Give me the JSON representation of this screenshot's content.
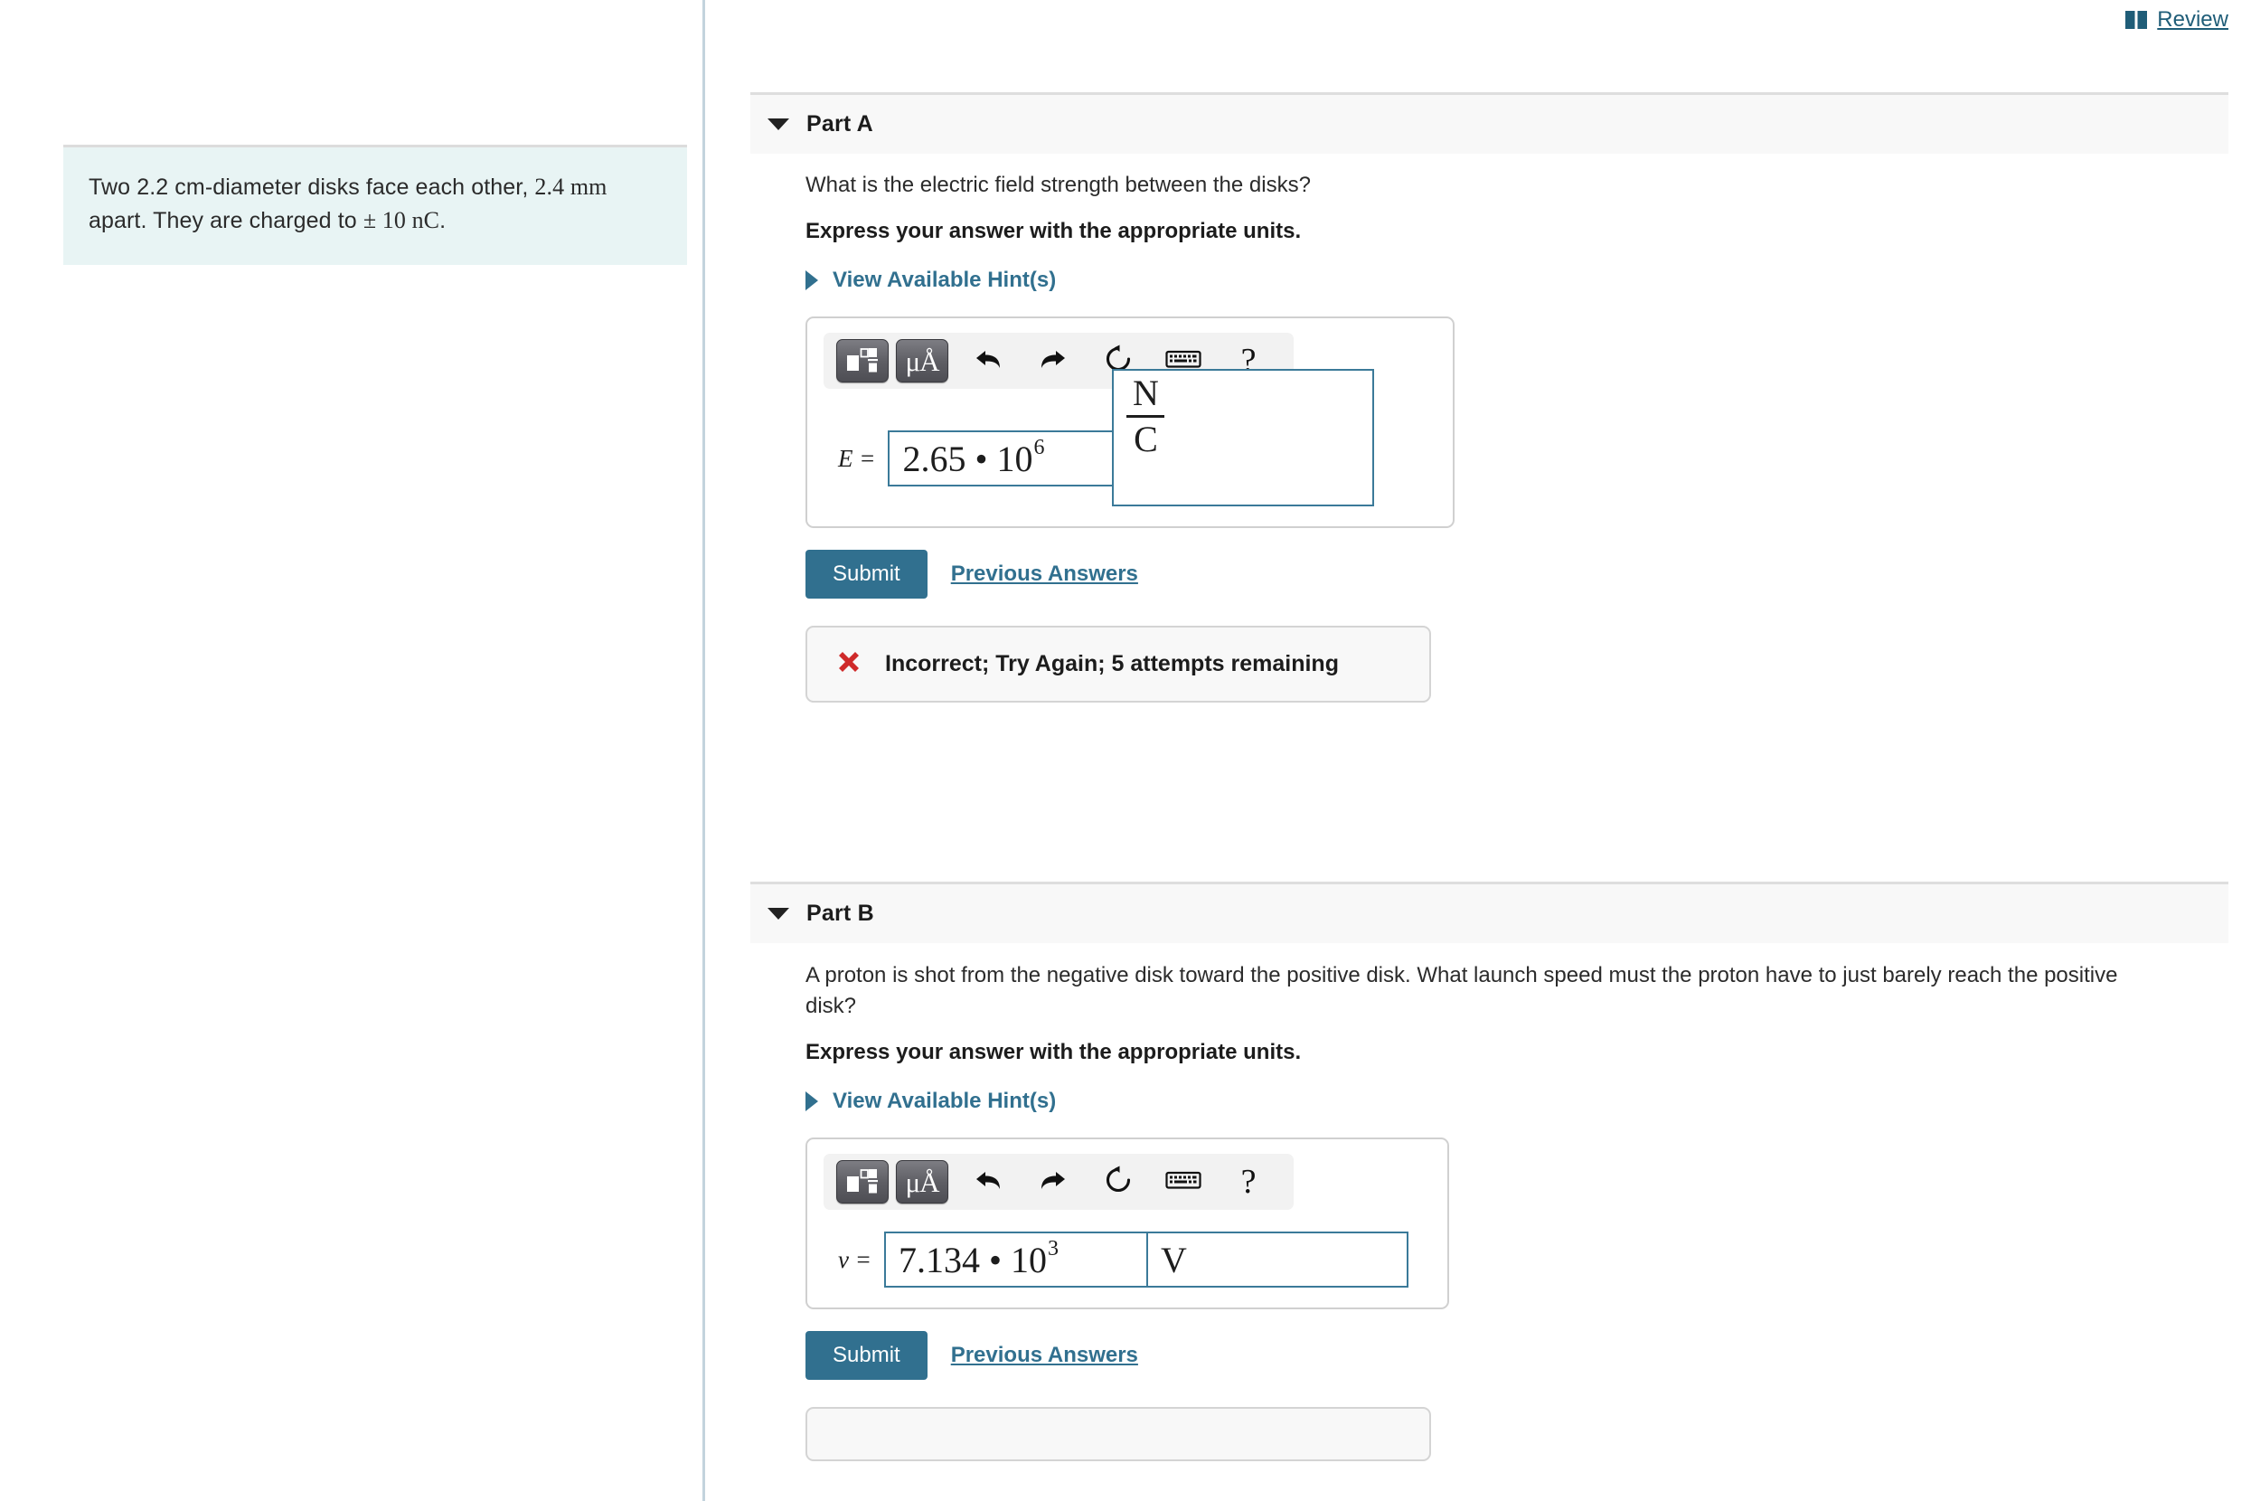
{
  "header": {
    "review_label": "Review",
    "book_icon": "book-icon"
  },
  "problem": {
    "text_part1": "Two 2.2 cm-diameter disks face each other, ",
    "text_math1": "2.4 mm",
    "text_part2": " apart. They are charged to  ",
    "text_math2": "± 10 nC",
    "text_part3": "."
  },
  "colors": {
    "accent": "#31708f",
    "link": "#1f5d78",
    "input_border": "#3b7a99",
    "problem_bg": "#e8f4f4",
    "panel_bg": "#f8f8f8",
    "error": "#cf2a2a"
  },
  "toolbar": {
    "template_button": "math-template-button",
    "units_button_label": "μÅ",
    "undo_label": "undo-icon",
    "redo_label": "redo-icon",
    "reset_label": "reset-icon",
    "keyboard_label": "keyboard-icon",
    "help_label": "?"
  },
  "parts": [
    {
      "title": "Part A",
      "question": "What is the electric field strength between the disks?",
      "express": "Express your answer with the appropriate units.",
      "hint_label": "View Available Hint(s)",
      "answer": {
        "variable": "E =",
        "value_mantissa": "2.65 • 10",
        "value_exponent": "6",
        "unit_numerator": "N",
        "unit_denominator": "C",
        "unit_is_fraction": true
      },
      "submit_label": "Submit",
      "previous_answers_label": "Previous Answers",
      "feedback": {
        "status": "incorrect",
        "icon": "x-mark-icon",
        "message": "Incorrect; Try Again; 5 attempts remaining"
      }
    },
    {
      "title": "Part B",
      "question": "A proton is shot from the negative disk toward the positive disk. What launch speed must the proton have to just barely reach the positive disk?",
      "express": "Express your answer with the appropriate units.",
      "hint_label": "View Available Hint(s)",
      "answer": {
        "variable": "v =",
        "value_mantissa": "7.134 • 10",
        "value_exponent": "3",
        "unit_numerator": "V",
        "unit_denominator": "",
        "unit_is_fraction": false
      },
      "submit_label": "Submit",
      "previous_answers_label": "Previous Answers"
    }
  ]
}
